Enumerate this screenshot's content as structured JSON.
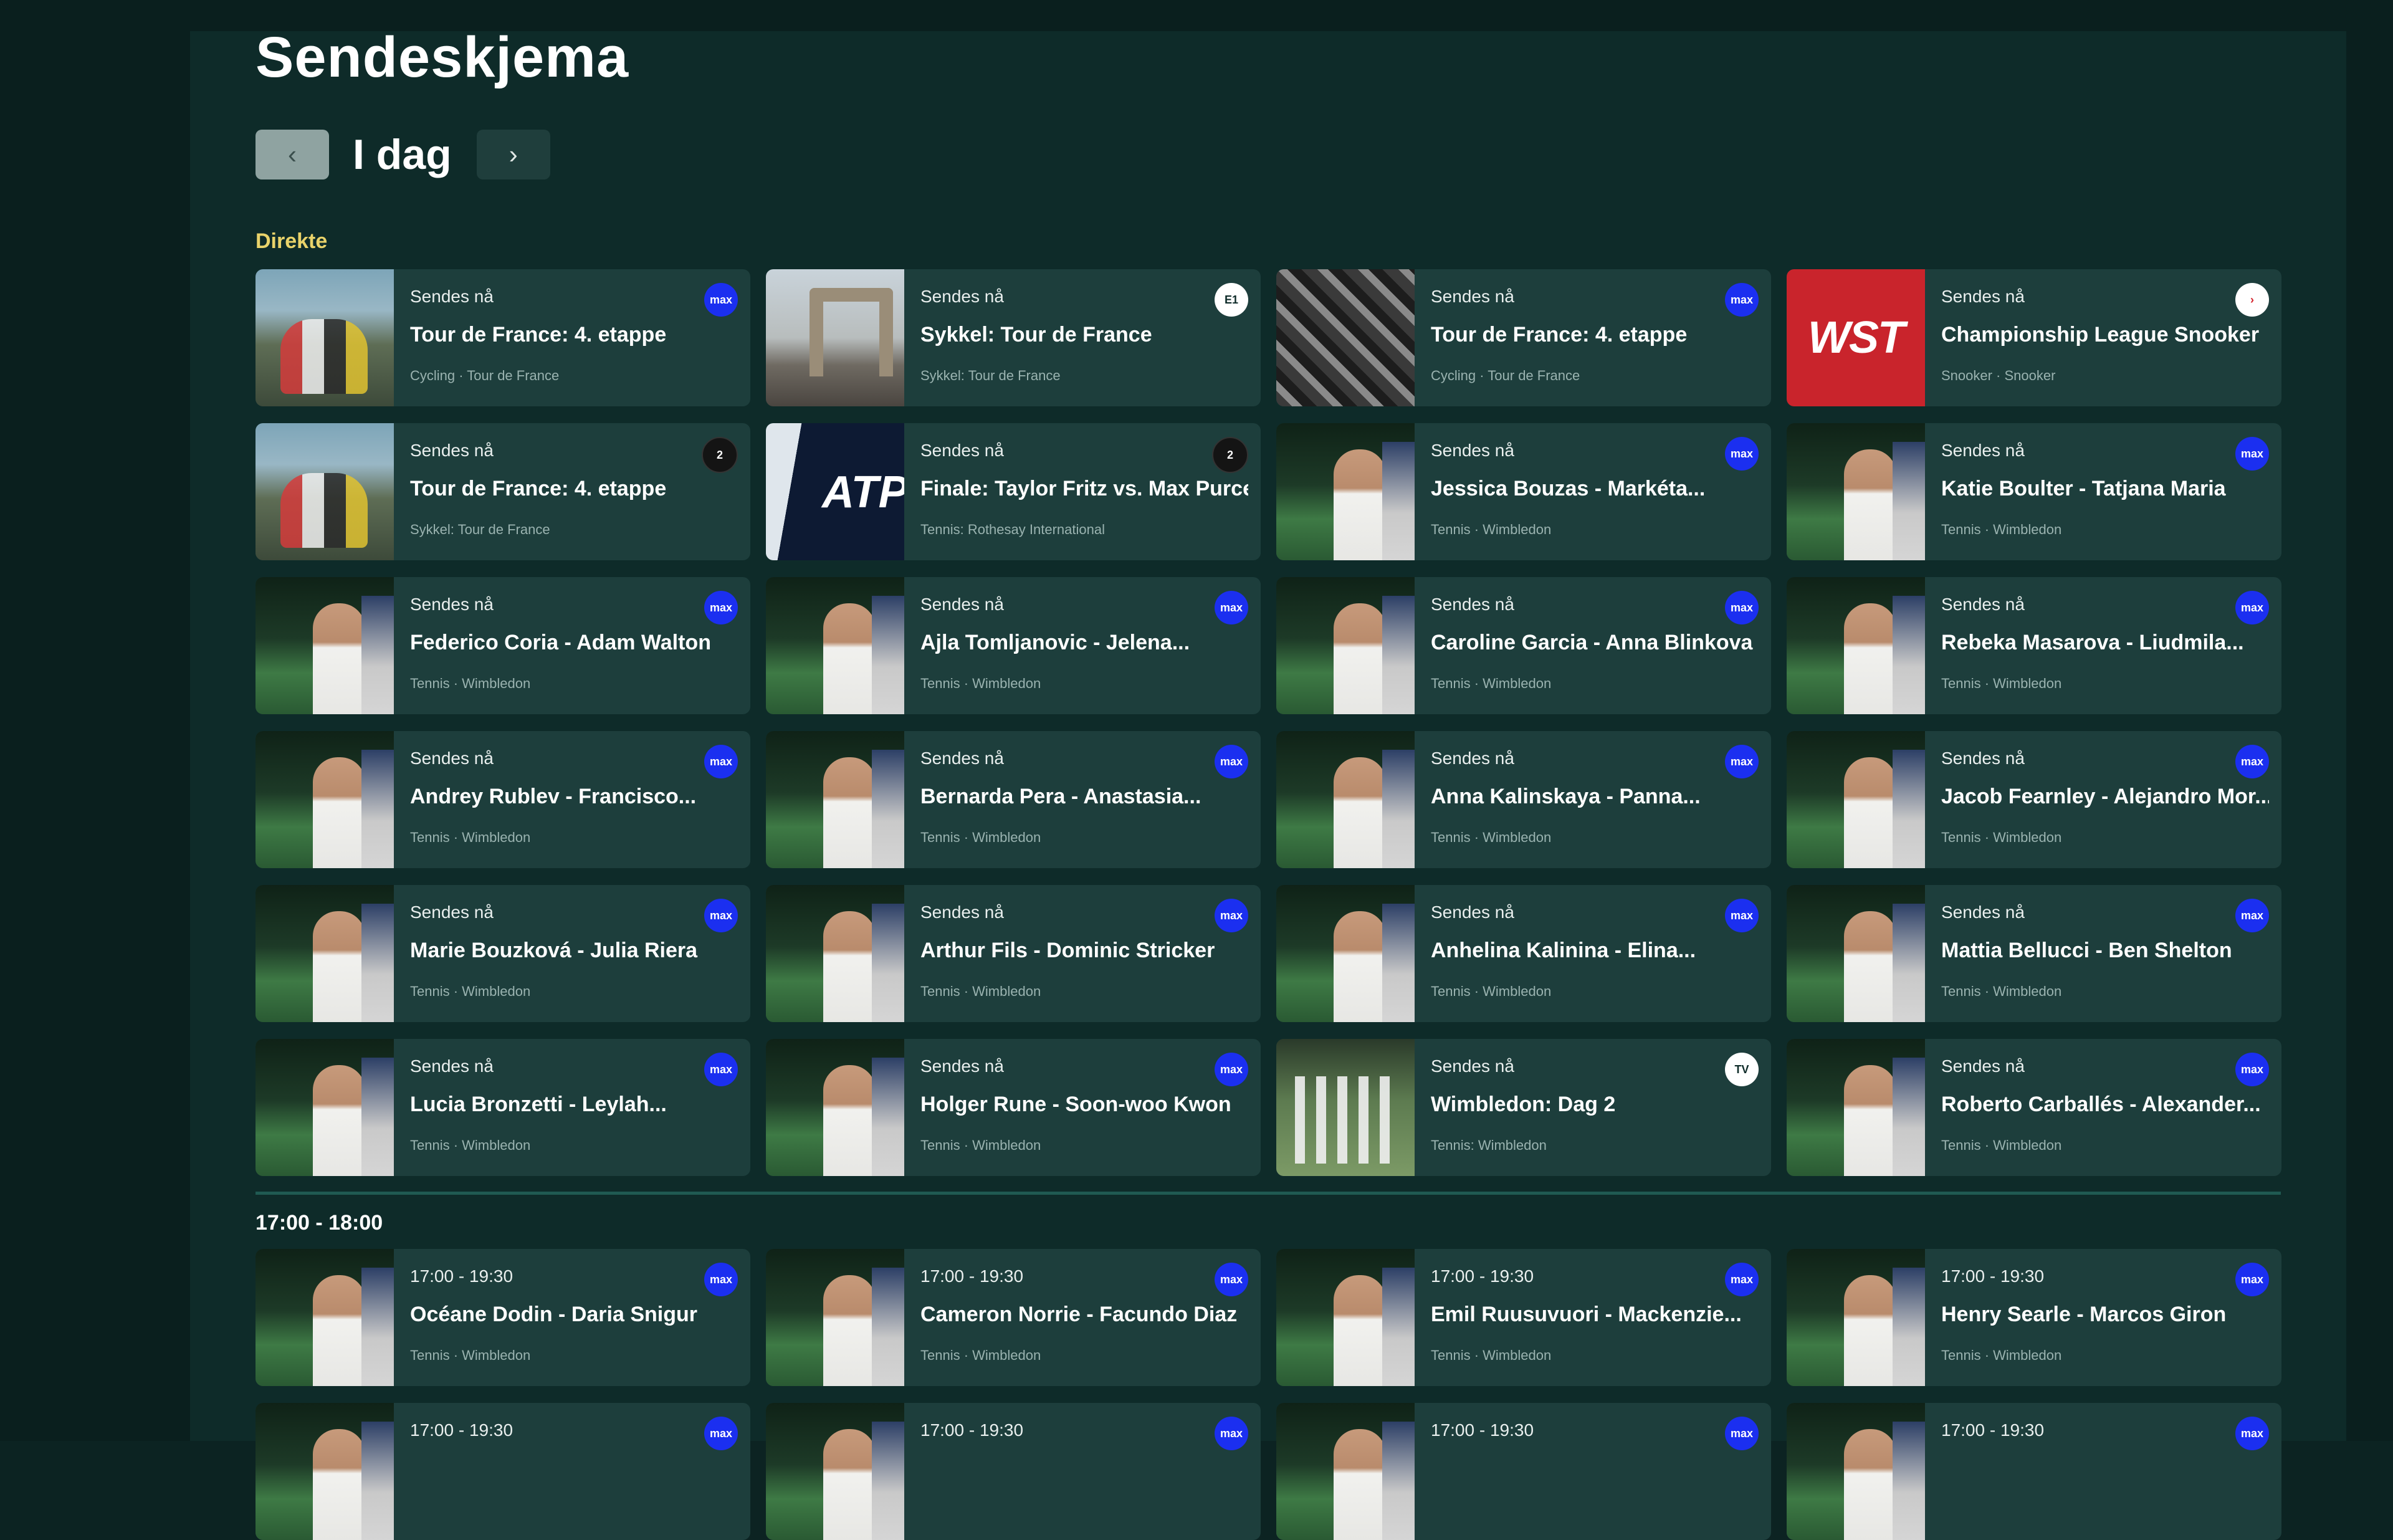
{
  "page": {
    "title": "Sendeskjema",
    "day_label": "I dag",
    "prev_icon": "chevron-left-icon",
    "next_icon": "chevron-right-icon",
    "prev_glyph": "‹",
    "next_glyph": "›"
  },
  "sections": {
    "live_label": "Direkte",
    "slot_label": "17:00 - 18:00"
  },
  "colors": {
    "background": "#0e2b29",
    "card": "#1d3e3c",
    "live_label": "#e9d36a",
    "max_badge": "#1b2ff0"
  },
  "live": [
    {
      "status": "Sendes nå",
      "name": "Tour de France: 4. etappe",
      "meta": "Cycling · Tour de France",
      "badge": "max",
      "badge_text": "max",
      "thumb": "cycling"
    },
    {
      "status": "Sendes nå",
      "name": "Sykkel: Tour de France",
      "meta": "Sykkel: Tour de France",
      "badge": "white",
      "badge_text": "E1",
      "thumb": "arch"
    },
    {
      "status": "Sendes nå",
      "name": "Tour de France: 4. etappe",
      "meta": "Cycling · Tour de France",
      "badge": "max",
      "badge_text": "max",
      "thumb": "crowd"
    },
    {
      "status": "Sendes nå",
      "name": "Championship League Snooker",
      "meta": "Snooker · Snooker",
      "badge": "red",
      "badge_text": "›",
      "thumb": "wst"
    },
    {
      "status": "Sendes nå",
      "name": "Tour de France: 4. etappe",
      "meta": "Sykkel: Tour de France",
      "badge": "tv2",
      "badge_text": "2",
      "thumb": "cycling"
    },
    {
      "status": "Sendes nå",
      "name": "Finale: Taylor Fritz vs. Max Purcell",
      "meta": "Tennis: Rothesay International",
      "badge": "tv2",
      "badge_text": "2",
      "thumb": "atp"
    },
    {
      "status": "Sendes nå",
      "name": "Jessica Bouzas - Markéta...",
      "meta": "Tennis · Wimbledon",
      "badge": "max",
      "badge_text": "max",
      "thumb": "tennis"
    },
    {
      "status": "Sendes nå",
      "name": "Katie Boulter - Tatjana Maria",
      "meta": "Tennis · Wimbledon",
      "badge": "max",
      "badge_text": "max",
      "thumb": "tennis"
    },
    {
      "status": "Sendes nå",
      "name": "Federico Coria - Adam Walton",
      "meta": "Tennis · Wimbledon",
      "badge": "max",
      "badge_text": "max",
      "thumb": "tennis"
    },
    {
      "status": "Sendes nå",
      "name": "Ajla Tomljanovic - Jelena...",
      "meta": "Tennis · Wimbledon",
      "badge": "max",
      "badge_text": "max",
      "thumb": "tennis"
    },
    {
      "status": "Sendes nå",
      "name": "Caroline Garcia - Anna Blinkova",
      "meta": "Tennis · Wimbledon",
      "badge": "max",
      "badge_text": "max",
      "thumb": "tennis"
    },
    {
      "status": "Sendes nå",
      "name": "Rebeka Masarova - Liudmila...",
      "meta": "Tennis · Wimbledon",
      "badge": "max",
      "badge_text": "max",
      "thumb": "tennis"
    },
    {
      "status": "Sendes nå",
      "name": "Andrey Rublev - Francisco...",
      "meta": "Tennis · Wimbledon",
      "badge": "max",
      "badge_text": "max",
      "thumb": "tennis"
    },
    {
      "status": "Sendes nå",
      "name": "Bernarda Pera - Anastasia...",
      "meta": "Tennis · Wimbledon",
      "badge": "max",
      "badge_text": "max",
      "thumb": "tennis"
    },
    {
      "status": "Sendes nå",
      "name": "Anna Kalinskaya - Panna...",
      "meta": "Tennis · Wimbledon",
      "badge": "max",
      "badge_text": "max",
      "thumb": "tennis"
    },
    {
      "status": "Sendes nå",
      "name": "Jacob Fearnley - Alejandro Mor...",
      "meta": "Tennis · Wimbledon",
      "badge": "max",
      "badge_text": "max",
      "thumb": "tennis"
    },
    {
      "status": "Sendes nå",
      "name": "Marie Bouzková - Julia Riera",
      "meta": "Tennis · Wimbledon",
      "badge": "max",
      "badge_text": "max",
      "thumb": "tennis"
    },
    {
      "status": "Sendes nå",
      "name": "Arthur Fils - Dominic Stricker",
      "meta": "Tennis · Wimbledon",
      "badge": "max",
      "badge_text": "max",
      "thumb": "tennis"
    },
    {
      "status": "Sendes nå",
      "name": "Anhelina Kalinina - Elina...",
      "meta": "Tennis · Wimbledon",
      "badge": "max",
      "badge_text": "max",
      "thumb": "tennis"
    },
    {
      "status": "Sendes nå",
      "name": "Mattia Bellucci - Ben Shelton",
      "meta": "Tennis · Wimbledon",
      "badge": "max",
      "badge_text": "max",
      "thumb": "tennis"
    },
    {
      "status": "Sendes nå",
      "name": "Lucia Bronzetti - Leylah...",
      "meta": "Tennis · Wimbledon",
      "badge": "max",
      "badge_text": "max",
      "thumb": "tennis"
    },
    {
      "status": "Sendes nå",
      "name": "Holger Rune - Soon-woo Kwon",
      "meta": "Tennis · Wimbledon",
      "badge": "max",
      "badge_text": "max",
      "thumb": "tennis"
    },
    {
      "status": "Sendes nå",
      "name": "Wimbledon: Dag 2",
      "meta": "Tennis: Wimbledon",
      "badge": "white",
      "badge_text": "TV",
      "thumb": "walk"
    },
    {
      "status": "Sendes nå",
      "name": "Roberto Carballés - Alexander...",
      "meta": "Tennis · Wimbledon",
      "badge": "max",
      "badge_text": "max",
      "thumb": "tennis"
    }
  ],
  "upcoming": [
    {
      "status": "17:00 - 19:30",
      "name": "Océane Dodin - Daria Snigur",
      "meta": "Tennis · Wimbledon",
      "badge": "max",
      "badge_text": "max",
      "thumb": "tennis"
    },
    {
      "status": "17:00 - 19:30",
      "name": "Cameron Norrie - Facundo Diaz",
      "meta": "Tennis · Wimbledon",
      "badge": "max",
      "badge_text": "max",
      "thumb": "tennis"
    },
    {
      "status": "17:00 - 19:30",
      "name": "Emil Ruusuvuori - Mackenzie...",
      "meta": "Tennis · Wimbledon",
      "badge": "max",
      "badge_text": "max",
      "thumb": "tennis"
    },
    {
      "status": "17:00 - 19:30",
      "name": "Henry Searle - Marcos Giron",
      "meta": "Tennis · Wimbledon",
      "badge": "max",
      "badge_text": "max",
      "thumb": "tennis"
    },
    {
      "status": "17:00 - 19:30",
      "name": "",
      "meta": "",
      "badge": "max",
      "badge_text": "max",
      "thumb": "tennis"
    },
    {
      "status": "17:00 - 19:30",
      "name": "",
      "meta": "",
      "badge": "max",
      "badge_text": "max",
      "thumb": "tennis"
    },
    {
      "status": "17:00 - 19:30",
      "name": "",
      "meta": "",
      "badge": "max",
      "badge_text": "max",
      "thumb": "tennis"
    },
    {
      "status": "17:00 - 19:30",
      "name": "",
      "meta": "",
      "badge": "max",
      "badge_text": "max",
      "thumb": "tennis"
    }
  ]
}
